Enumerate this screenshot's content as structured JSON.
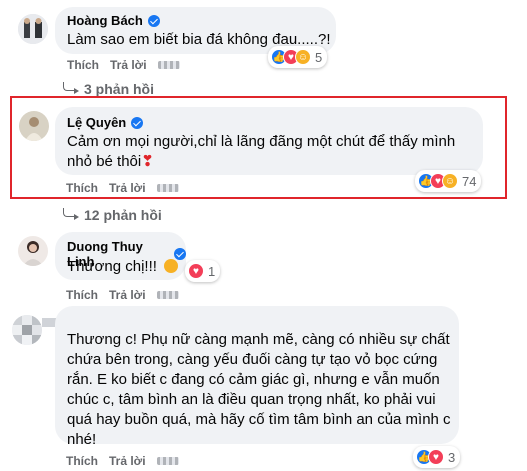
{
  "comments": [
    {
      "author": "Hoàng Bách",
      "text": "Làm sao em biết bia đá không đau.....?!",
      "like_label": "Thích",
      "reply_label": "Trả lời",
      "reaction_count": "5",
      "replies_label": "3 phản hồi"
    },
    {
      "author": "Lệ Quyên",
      "text_line1": "Cảm ơn mọi người,chỉ là lãng đãng một chút để thấy mình",
      "text_line2": "nhỏ bé thôi",
      "like_label": "Thích",
      "reply_label": "Trả lời",
      "reaction_count": "74",
      "replies_label": "12 phản hồi"
    },
    {
      "author": "Duong Thuy Linh",
      "text": "Thương chị!!!",
      "like_label": "Thích",
      "reply_label": "Trả lời",
      "reaction_count": "1"
    },
    {
      "text_lines": [
        "Thương c! Phụ nữ càng mạnh mẽ, càng có nhiều sự chất",
        "chứa bên trong, càng yếu đuối càng tự tạo vỏ bọc cứng",
        "rắn. E ko biết c đang có cảm giác gì, nhưng e vẫn muốn",
        "chúc c, tâm bình an là điều quan trọng nhất, ko phải vui",
        "quá hay buồn quá, mà hãy cố tìm tâm bình an của mình c",
        "nhé!"
      ],
      "like_label": "Thích",
      "reply_label": "Trả lời",
      "reaction_count": "3"
    }
  ],
  "colors": {
    "highlight_border": "#e0252b",
    "verified": "#1877f2",
    "bubble": "#f0f2f5",
    "meta_text": "#65676b"
  }
}
